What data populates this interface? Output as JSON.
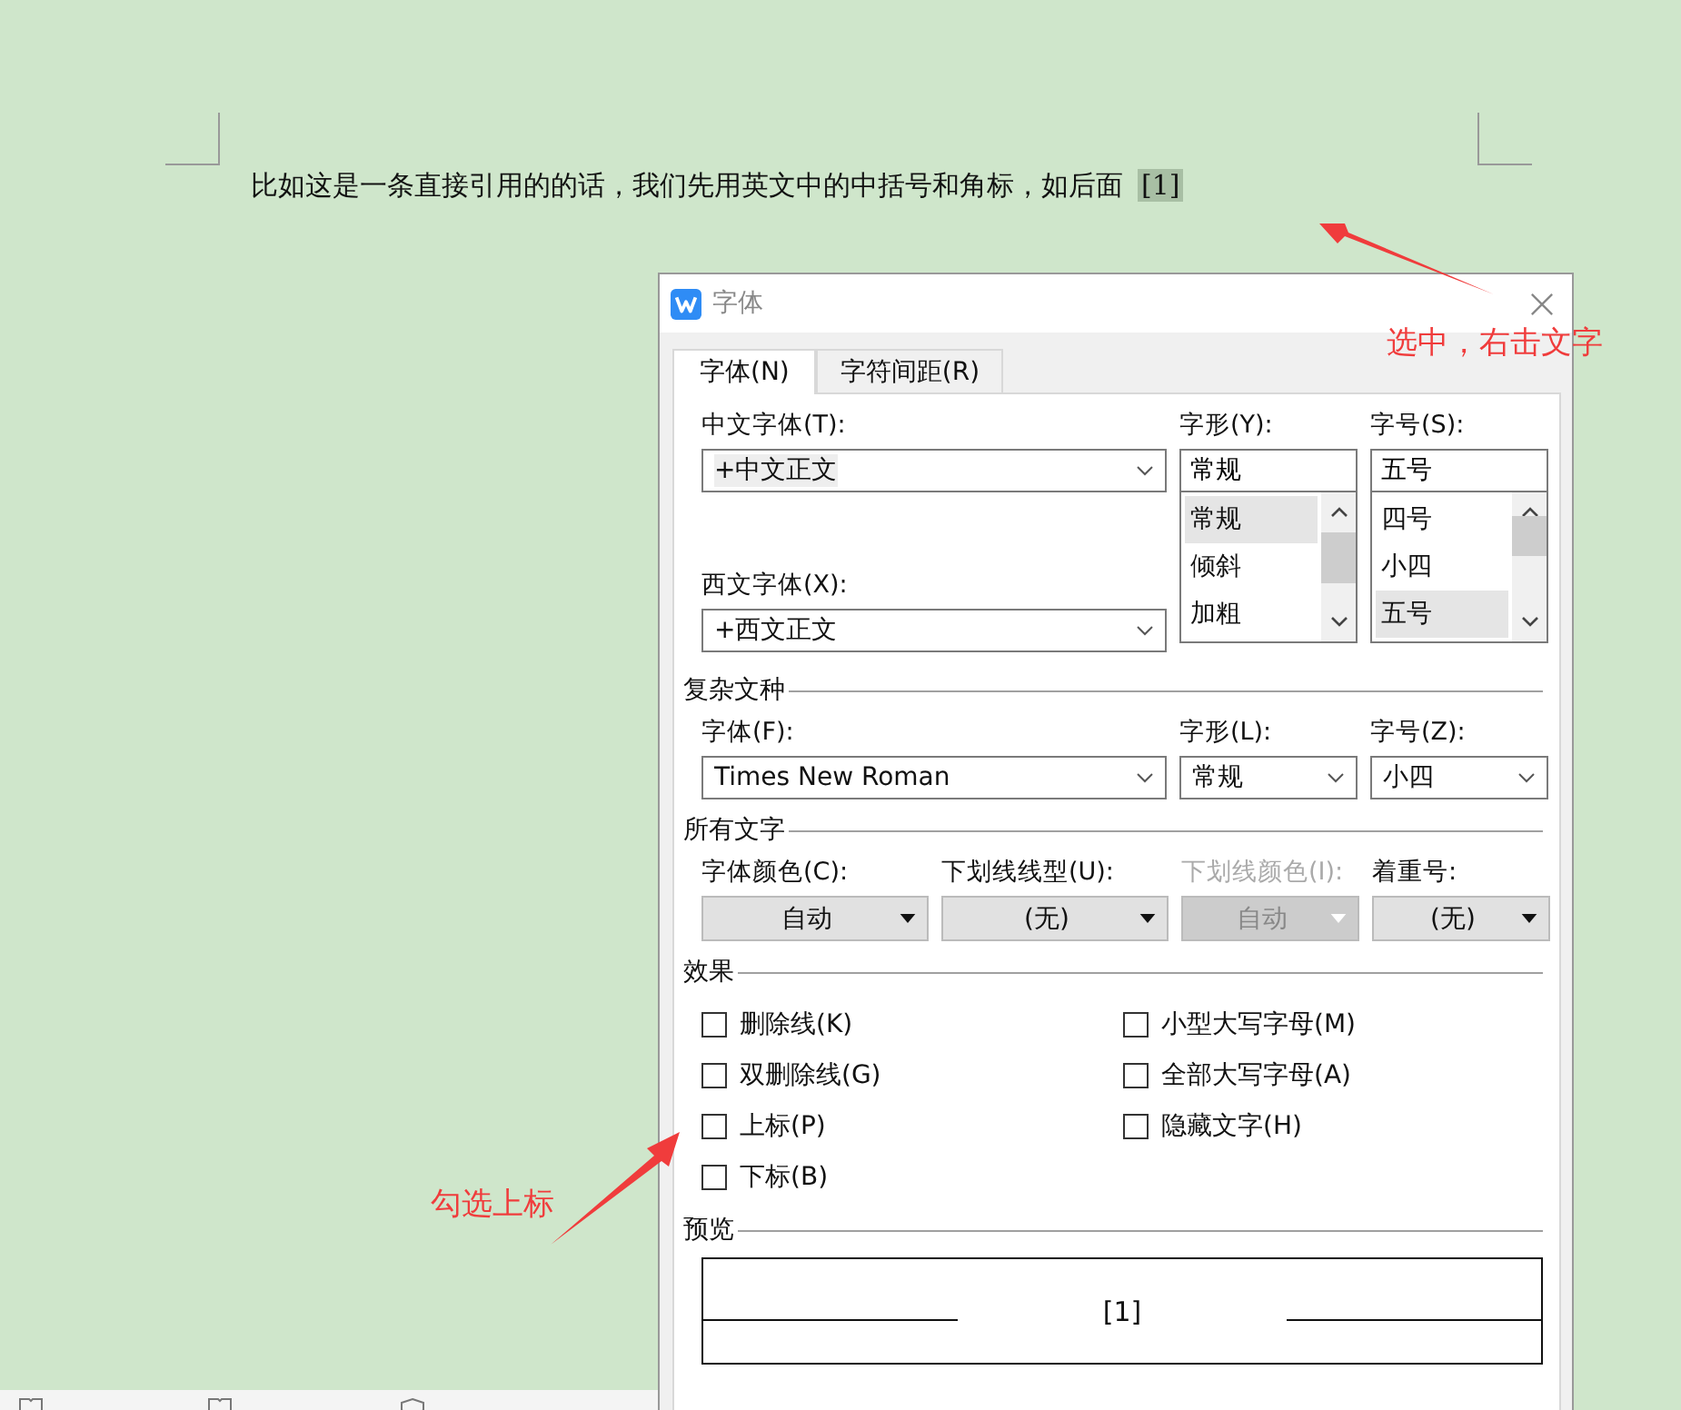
{
  "document": {
    "paragraph": "比如这是一条直接引用的的话，我们先用英文中的中括号和角标，如后面",
    "selected_text": "[1]"
  },
  "dialog": {
    "title": "字体",
    "tabs": [
      {
        "label": "字体(N)",
        "selected": true
      },
      {
        "label": "字符间距(R)",
        "selected": false
      }
    ],
    "chinese_font": {
      "label": "中文字体(T):",
      "value": "+中文正文"
    },
    "western_font": {
      "label": "西文字体(X):",
      "value": "+西文正文"
    },
    "style": {
      "label": "字形(Y):",
      "value": "常规",
      "options": [
        {
          "label": "常规",
          "selected": true
        },
        {
          "label": "倾斜",
          "selected": false
        },
        {
          "label": "加粗",
          "selected": false
        }
      ]
    },
    "size": {
      "label": "字号(S):",
      "value": "五号",
      "options": [
        {
          "label": "四号",
          "selected": false
        },
        {
          "label": "小四",
          "selected": false
        },
        {
          "label": "五号",
          "selected": true
        }
      ]
    },
    "complex": {
      "heading": "复杂文种",
      "font": {
        "label": "字体(F):",
        "value": "Times New Roman"
      },
      "style": {
        "label": "字形(L):",
        "value": "常规"
      },
      "size": {
        "label": "字号(Z):",
        "value": "小四"
      }
    },
    "all_text": {
      "heading": "所有文字",
      "fields": [
        {
          "label": "字体颜色(C):",
          "value": "自动",
          "disabled": false
        },
        {
          "label": "下划线线型(U):",
          "value": "(无)",
          "disabled": false
        },
        {
          "label": "下划线颜色(I):",
          "value": "自动",
          "disabled": true
        },
        {
          "label": "着重号:",
          "value": "(无)",
          "disabled": false
        }
      ]
    },
    "effects": {
      "heading": "效果",
      "options": [
        {
          "label": "删除线(K)",
          "checked": false
        },
        {
          "label": "小型大写字母(M)",
          "checked": false
        },
        {
          "label": "双删除线(G)",
          "checked": false
        },
        {
          "label": "全部大写字母(A)",
          "checked": false
        },
        {
          "label": "上标(P)",
          "checked": false
        },
        {
          "label": "隐藏文字(H)",
          "checked": false
        },
        {
          "label": "下标(B)",
          "checked": false
        }
      ]
    },
    "preview": {
      "heading": "预览",
      "text": "[1]"
    }
  },
  "annotations": [
    {
      "text": "选中，右击文字"
    },
    {
      "text": "勾选上标"
    }
  ]
}
